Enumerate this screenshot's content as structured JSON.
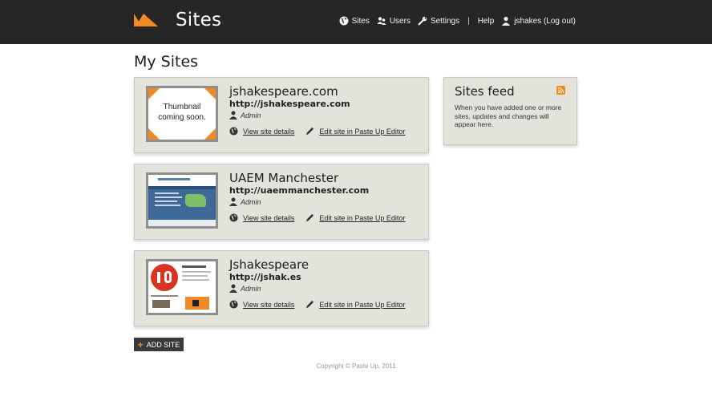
{
  "header": {
    "app_title": "Sites",
    "nav": {
      "sites": "Sites",
      "users": "Users",
      "settings": "Settings",
      "separator": "|",
      "help": "Help",
      "user": "jshakes (Log out)"
    }
  },
  "page_title": "My Sites",
  "sites": [
    {
      "name": "jshakespeare.com",
      "url": "http://jshakespeare.com",
      "role": "Admin",
      "thumb_text_1": "Thumbnail",
      "thumb_text_2": "coming soon.",
      "view_label": "View site details",
      "edit_label": "Edit site in Paste Up Editor"
    },
    {
      "name": "UAEM Manchester",
      "url": "http://uaemmanchester.com",
      "role": "Admin",
      "view_label": "View site details",
      "edit_label": "Edit site in Paste Up Editor"
    },
    {
      "name": "Jshakespeare",
      "url": "http://jshak.es",
      "role": "Admin",
      "view_label": "View site details",
      "edit_label": "Edit site in Paste Up Editor"
    }
  ],
  "feed": {
    "title": "Sites feed",
    "text": "When you have added one or more sites, updates and changes will appear here."
  },
  "add_button": {
    "icon": "+",
    "label": "ADD SITE"
  },
  "footer": "Copyright © Paste Up, 2011",
  "colors": {
    "accent": "#f08a24",
    "header_bg": "#262626",
    "card_bg": "#e3e3dc"
  }
}
